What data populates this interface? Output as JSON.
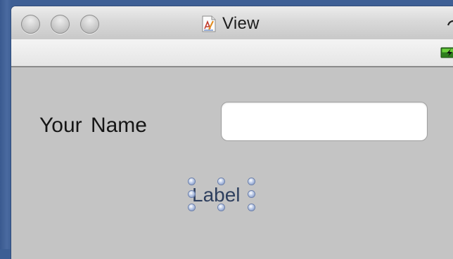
{
  "window": {
    "title": "View",
    "title_icon": "document-app-icon",
    "traffic_lights": [
      "close",
      "minimize",
      "zoom"
    ],
    "toolbar_toggle_icon": "toolbar-toggle-icon",
    "status_icon": "battery-charging-icon"
  },
  "form": {
    "name_label": "Your  Name",
    "name_value": "",
    "output_label": "Label"
  },
  "colors": {
    "window_background": "#c4c4c4",
    "desktop": "#3c5e94",
    "label_text": "#2e3f5e"
  }
}
